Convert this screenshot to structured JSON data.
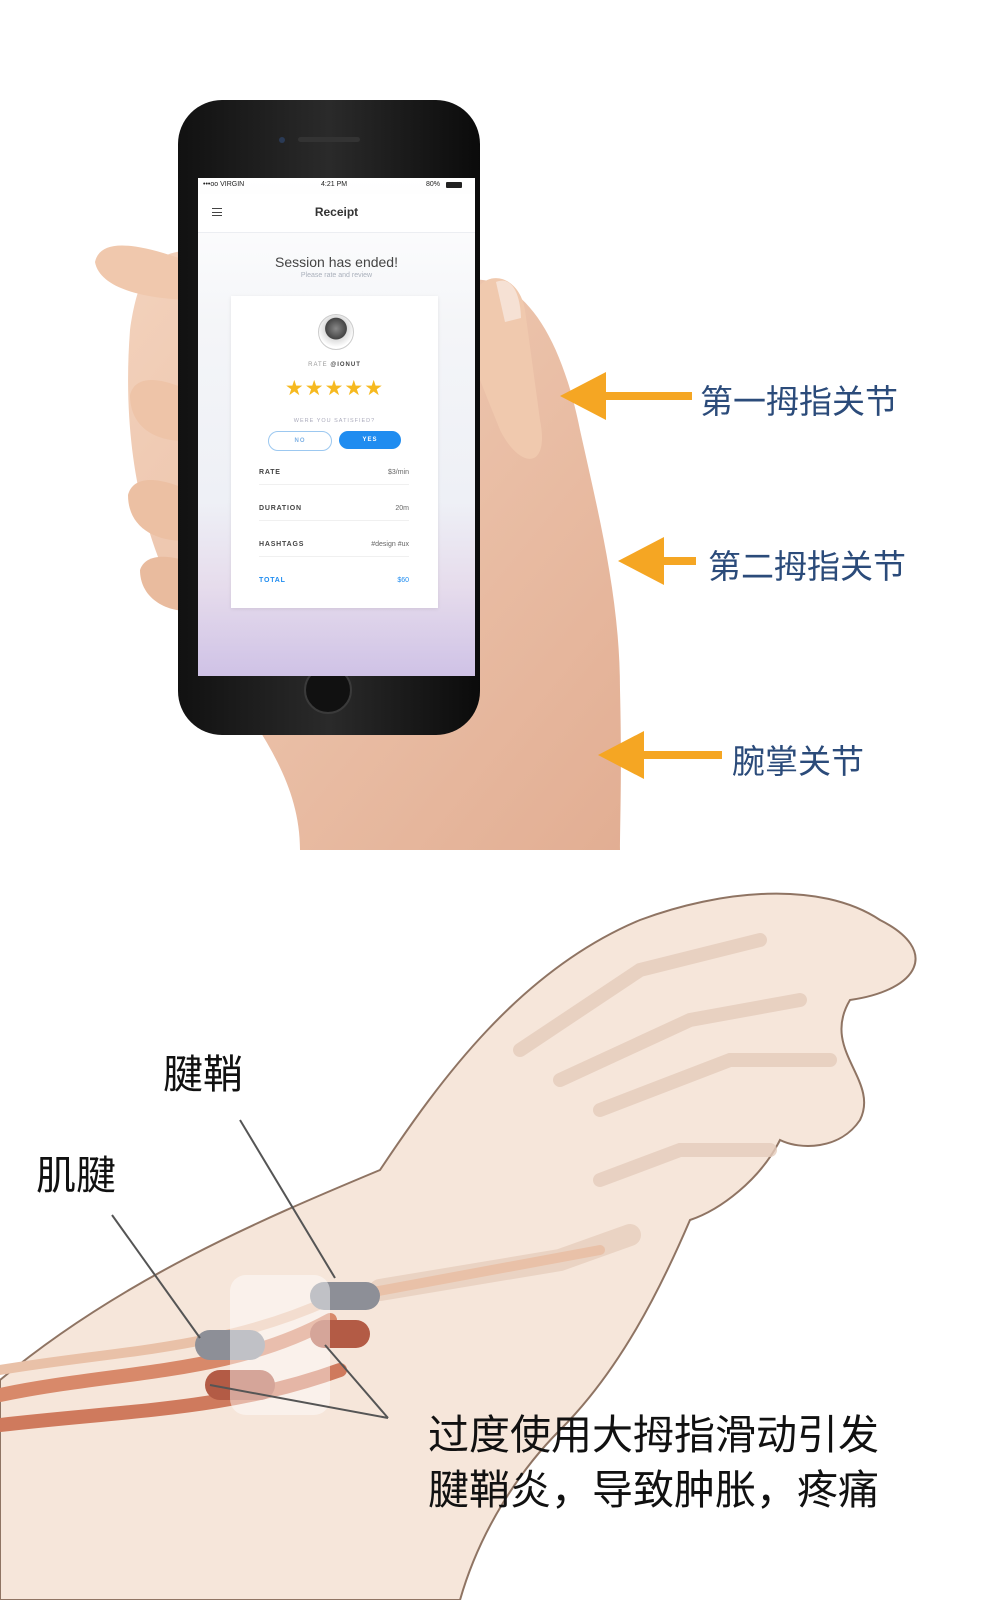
{
  "phone_screen": {
    "status": {
      "carrier": "•••oo VIRGIN",
      "time": "4:21 PM",
      "battery": "80%"
    },
    "nav_title": "Receipt",
    "headline": "Session has ended!",
    "subline": "Please rate and review",
    "rate_prefix": "RATE",
    "rate_user": "@IONUT",
    "stars": "★★★★★",
    "rating_stars": 5,
    "satisfied_question": "WERE YOU SATISFIED?",
    "no_label": "NO",
    "yes_label": "YES",
    "rows": [
      {
        "key": "RATE",
        "value": "$3/min"
      },
      {
        "key": "DURATION",
        "value": "20m"
      },
      {
        "key": "HASHTAGS",
        "value": "#design #ux"
      },
      {
        "key": "TOTAL",
        "value": "$60"
      }
    ]
  },
  "arrow_labels": [
    "第一拇指关节",
    "第二拇指关节",
    "腕掌关节"
  ],
  "anatomy_labels": {
    "sheath": "腱鞘",
    "tendon": "肌腱"
  },
  "caption": [
    "过度使用大拇指滑动引发",
    "腱鞘炎，导致肿胀，疼痛"
  ],
  "colors": {
    "arrow": "#f5a623",
    "accent_blue": "#1f8cf0",
    "star": "#f6b91f",
    "label_blue": "#2b4b7a"
  }
}
